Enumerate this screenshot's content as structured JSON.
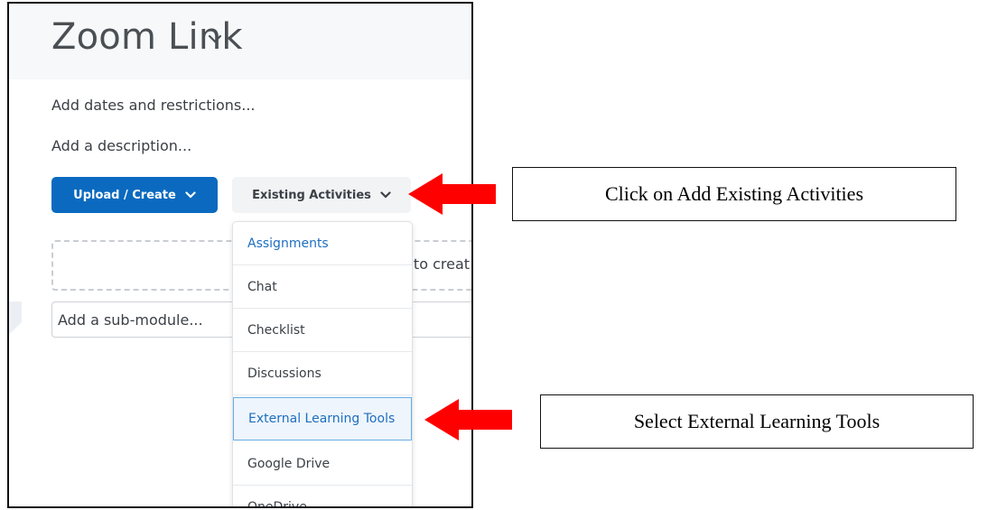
{
  "page": {
    "title": "Zoom Link",
    "add_dates": "Add dates and restrictions...",
    "add_description": "Add a description...",
    "upload_create_label": "Upload / Create",
    "existing_activities_label": "Existing Activities",
    "dropzone_text": "e to creat",
    "submodule_label": "Add a sub-module..."
  },
  "menu": {
    "items": [
      {
        "label": "Assignments"
      },
      {
        "label": "Chat"
      },
      {
        "label": "Checklist"
      },
      {
        "label": "Discussions"
      },
      {
        "label": "External Learning Tools",
        "selected": true
      },
      {
        "label": "Google Drive"
      },
      {
        "label": "OneDrive"
      }
    ]
  },
  "annotations": {
    "callout_1": "Click on Add Existing Activities",
    "callout_2": "Select External Learning Tools"
  },
  "colors": {
    "primary_button": "#0b6abf",
    "link_blue": "#1e6fbf",
    "arrow_red": "#ff0000"
  }
}
